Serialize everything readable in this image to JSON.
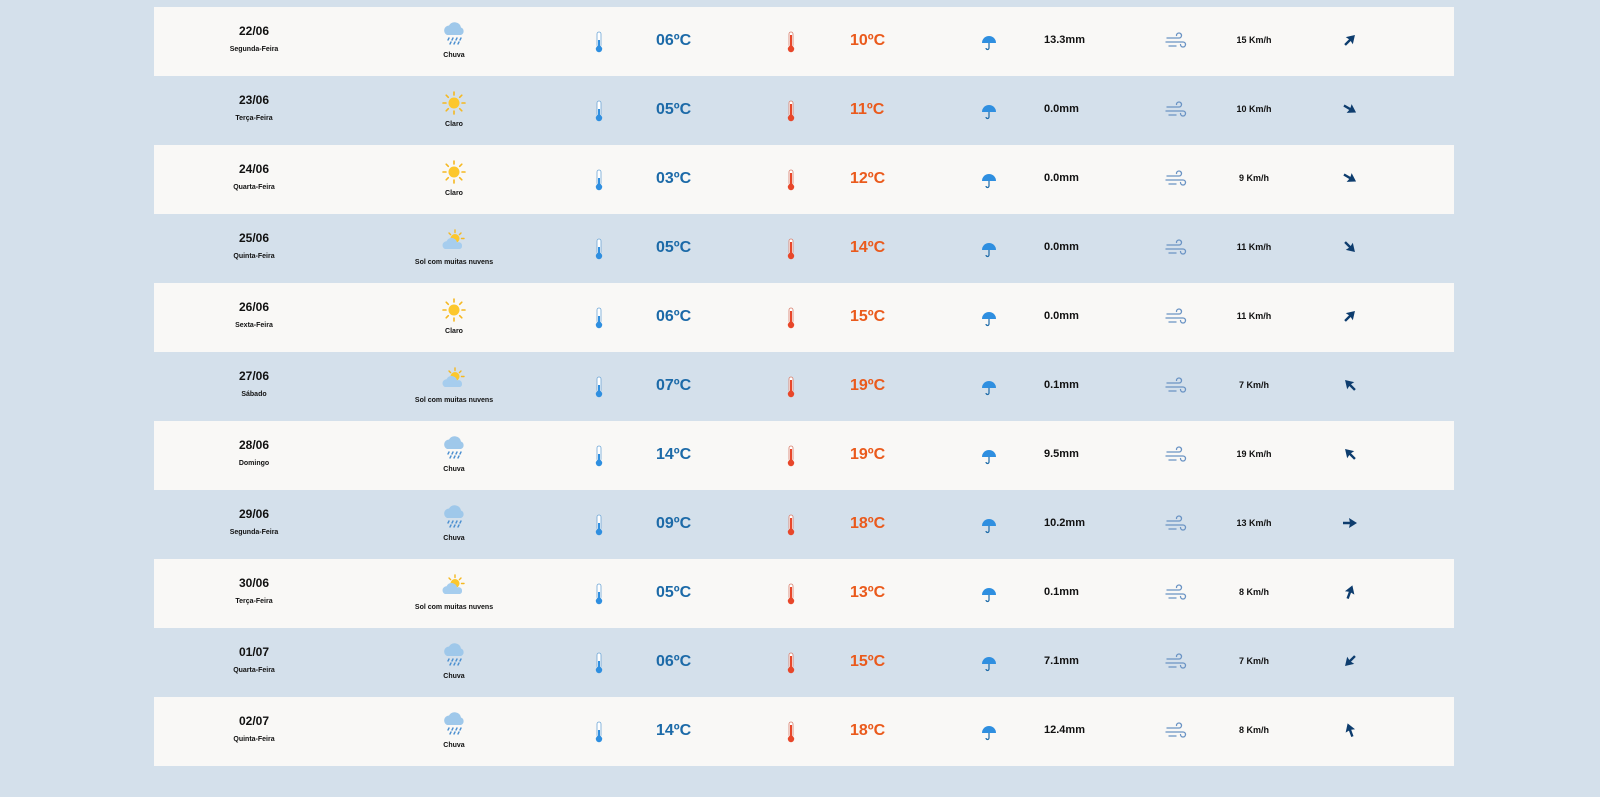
{
  "colors": {
    "cold": "#1c6aa8",
    "hot": "#ea5a1c",
    "page_bg": "#d4e0eb",
    "row_light": "#f9f8f6"
  },
  "days": [
    {
      "date": "22/06",
      "weekday": "Segunda-Feira",
      "icon": "rain-cloud-icon",
      "condition": "Chuva",
      "min": "06ºC",
      "max": "10ºC",
      "rain": "13.3mm",
      "wind": "15 Km/h",
      "wind_dir_deg": 45
    },
    {
      "date": "23/06",
      "weekday": "Terça-Feira",
      "icon": "sun-icon",
      "condition": "Claro",
      "min": "05ºC",
      "max": "11ºC",
      "rain": "0.0mm",
      "wind": "10 Km/h",
      "wind_dir_deg": 120
    },
    {
      "date": "24/06",
      "weekday": "Quarta-Feira",
      "icon": "sun-icon",
      "condition": "Claro",
      "min": "03ºC",
      "max": "12ºC",
      "rain": "0.0mm",
      "wind": "9 Km/h",
      "wind_dir_deg": 120
    },
    {
      "date": "25/06",
      "weekday": "Quinta-Feira",
      "icon": "sun-cloud-icon",
      "condition": "Sol com muitas nuvens",
      "min": "05ºC",
      "max": "14ºC",
      "rain": "0.0mm",
      "wind": "11 Km/h",
      "wind_dir_deg": 135
    },
    {
      "date": "26/06",
      "weekday": "Sexta-Feira",
      "icon": "sun-icon",
      "condition": "Claro",
      "min": "06ºC",
      "max": "15ºC",
      "rain": "0.0mm",
      "wind": "11 Km/h",
      "wind_dir_deg": 45
    },
    {
      "date": "27/06",
      "weekday": "Sábado",
      "icon": "sun-cloud-icon",
      "condition": "Sol com muitas nuvens",
      "min": "07ºC",
      "max": "19ºC",
      "rain": "0.1mm",
      "wind": "7 Km/h",
      "wind_dir_deg": 315
    },
    {
      "date": "28/06",
      "weekday": "Domingo",
      "icon": "rain-cloud-icon",
      "condition": "Chuva",
      "min": "14ºC",
      "max": "19ºC",
      "rain": "9.5mm",
      "wind": "19 Km/h",
      "wind_dir_deg": 315
    },
    {
      "date": "29/06",
      "weekday": "Segunda-Feira",
      "icon": "rain-cloud-icon",
      "condition": "Chuva",
      "min": "09ºC",
      "max": "18ºC",
      "rain": "10.2mm",
      "wind": "13 Km/h",
      "wind_dir_deg": 90
    },
    {
      "date": "30/06",
      "weekday": "Terça-Feira",
      "icon": "sun-cloud-icon",
      "condition": "Sol com muitas nuvens",
      "min": "05ºC",
      "max": "13ºC",
      "rain": "0.1mm",
      "wind": "8 Km/h",
      "wind_dir_deg": 20
    },
    {
      "date": "01/07",
      "weekday": "Quarta-Feira",
      "icon": "rain-cloud-icon",
      "condition": "Chuva",
      "min": "06ºC",
      "max": "15ºC",
      "rain": "7.1mm",
      "wind": "7 Km/h",
      "wind_dir_deg": 225
    },
    {
      "date": "02/07",
      "weekday": "Quinta-Feira",
      "icon": "rain-cloud-icon",
      "condition": "Chuva",
      "min": "14ºC",
      "max": "18ºC",
      "rain": "12.4mm",
      "wind": "8 Km/h",
      "wind_dir_deg": 340
    }
  ]
}
